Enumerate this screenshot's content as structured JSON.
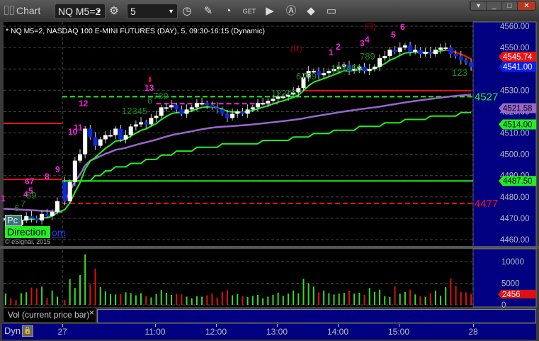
{
  "window": {
    "title": "Chart",
    "symbol": "NQ M5=2",
    "interval": "5"
  },
  "chart_header": "* NQ M5=2, NASDAQ 100 E-MINI FUTURES (DAY), 5, 09:30-16:15 (Dynamic)",
  "colors": {
    "up": "#ffffff",
    "down": "#0a28e6",
    "ema": "#22ee22",
    "vwap": "#9966cc",
    "red": "#ee1111",
    "magenta": "#ff22dd",
    "dkgreen": "#1a8a1a",
    "axis_bg": "#000080"
  },
  "price_axis": {
    "ticks": [
      "4560.00",
      "4550.00",
      "4530.00",
      "4520.00",
      "4510.00",
      "4500.00",
      "4490.00",
      "4480.00",
      "4470.00",
      "4460.00"
    ],
    "badges": [
      {
        "label": "4545.74",
        "color": "#ee1111",
        "value": 4545.74
      },
      {
        "label": "4541.00",
        "color": "#1020e8",
        "value": 4541.0
      },
      {
        "label": "4521.58",
        "color": "#9966cc",
        "value": 4521.58
      },
      {
        "label": "4514.00",
        "color": "#22ee22",
        "value": 4514.0
      },
      {
        "label": "4487.50",
        "color": "#22ee22",
        "value": 4487.5
      }
    ]
  },
  "level_labels": [
    {
      "label": "4527",
      "value": 4527,
      "color": "#22ee22"
    },
    {
      "label": "4477",
      "value": 4477,
      "color": "#ee1111"
    }
  ],
  "volume_axis": {
    "ticks": [
      "10000",
      "5000",
      "0"
    ],
    "badge": "2456"
  },
  "time_axis": [
    "27",
    "11:00",
    "12:00",
    "13:00",
    "14:00",
    "15:00",
    "28"
  ],
  "annotations": [
    {
      "t": "1",
      "c": "m"
    },
    {
      "t": "4",
      "c": "m"
    },
    {
      "t": "5",
      "c": "m"
    },
    {
      "t": "67",
      "c": "m"
    },
    {
      "t": "8",
      "c": "m"
    },
    {
      "t": "9",
      "c": "m"
    },
    {
      "t": "10",
      "c": "m"
    },
    {
      "t": "11",
      "c": "m"
    },
    {
      "t": "12",
      "c": "m"
    },
    {
      "t": "13",
      "c": "m"
    },
    {
      "t": "6",
      "c": "g"
    },
    {
      "t": "7",
      "c": "g"
    },
    {
      "t": "89",
      "c": "g"
    },
    {
      "t": "12345",
      "c": "g"
    },
    {
      "t": "6",
      "c": "g"
    },
    {
      "t": "789",
      "c": "g"
    },
    {
      "t": "12345",
      "c": "g"
    },
    {
      "t": "6789",
      "c": "g"
    },
    {
      "t": "(R)",
      "c": "r"
    },
    {
      "t": "1",
      "c": "m"
    },
    {
      "t": "2",
      "c": "m"
    },
    {
      "t": "123456",
      "c": "g"
    },
    {
      "t": "789",
      "c": "g"
    },
    {
      "t": "3",
      "c": "m"
    },
    {
      "t": "4",
      "c": "m"
    },
    {
      "t": "(R)",
      "c": "r"
    },
    {
      "t": "5",
      "c": "m"
    },
    {
      "t": "6",
      "c": "m"
    },
    {
      "t": "123",
      "c": "g"
    }
  ],
  "widgets": {
    "pc": "Pc",
    "direction": "Direction",
    "link": "om",
    "copyright": "© eSignal, 2015"
  },
  "volume_tab": {
    "label": "Vol (current price bar)",
    "close": "×"
  },
  "bottom": {
    "mode": "Dyn"
  },
  "chart_data": {
    "type": "candlestick",
    "ylim": [
      4460,
      4560
    ],
    "prev_day_closes": [
      4470,
      4468,
      4467,
      4469,
      4471,
      4470,
      4469,
      4472,
      4471,
      4473,
      4478
    ],
    "closes": [
      4478,
      4487,
      4497,
      4500,
      4512,
      4508,
      4504,
      4507,
      4509,
      4509,
      4512,
      4507,
      4509,
      4513,
      4514,
      4515,
      4514,
      4517,
      4518,
      4522,
      4522,
      4523,
      4521,
      4519,
      4521,
      4522,
      4524,
      4524,
      4523,
      4522,
      4521,
      4519,
      4517,
      4519,
      4520,
      4519,
      4521,
      4522,
      4524,
      4524,
      4525,
      4526,
      4527,
      4527,
      4528,
      4529,
      4531,
      4536,
      4539,
      4539,
      4537,
      4538,
      4539,
      4540,
      4541,
      4542,
      4539,
      4540,
      4541,
      4539,
      4540,
      4541,
      4545,
      4546,
      4549,
      4548,
      4550,
      4551,
      4548,
      4549,
      4547,
      4548,
      4547,
      4549,
      4550,
      4550,
      4547,
      4546,
      4544,
      4543,
      4541
    ],
    "first_open": 4487,
    "prev_volume": [
      2600,
      1500,
      1100,
      2700,
      2900,
      4000,
      3800,
      4200,
      1600,
      3300,
      1900
    ],
    "volume": [
      1100,
      6000,
      3900,
      6900,
      11700,
      4700,
      8400,
      4100,
      3100,
      2500,
      2400,
      2500,
      2900,
      2700,
      2200,
      2700,
      2000,
      1700,
      2500,
      3400,
      2800,
      2300,
      2500,
      2400,
      1900,
      1500,
      2000,
      1900,
      2200,
      2600,
      1700,
      3000,
      3400,
      2200,
      2500,
      2000,
      1800,
      2100,
      2300,
      1500,
      1900,
      2300,
      2800,
      2100,
      2600,
      3300,
      2700,
      6000,
      5000,
      4200,
      2900,
      3300,
      2700,
      2400,
      2600,
      2800,
      3300,
      2600,
      2800,
      2300,
      3900,
      3000,
      3500,
      2000,
      1800,
      4200,
      2600,
      3000,
      3500,
      2400,
      2000,
      1800,
      2700,
      3300,
      2100,
      4100,
      6100,
      4400,
      3000,
      2900,
      2456
    ],
    "levels": [
      {
        "value": 4514.5,
        "style": "solid",
        "color": "red",
        "range": "prev"
      },
      {
        "value": 4488.2,
        "style": "solid",
        "color": "red",
        "range": "prev"
      },
      {
        "value": 4487.5,
        "style": "solid",
        "color": "green",
        "range": "session"
      },
      {
        "value": 4477,
        "style": "dashed",
        "color": "red",
        "range": "session"
      },
      {
        "value": 4527,
        "style": "dashed",
        "color": "green",
        "range": "session"
      },
      {
        "value": 4529.8,
        "style": "solid",
        "color": "red",
        "from_bar": 47
      },
      {
        "value": 4523.7,
        "style": "dashed",
        "color": "magenta",
        "from_bar": 18,
        "to_bar": 42
      }
    ]
  }
}
